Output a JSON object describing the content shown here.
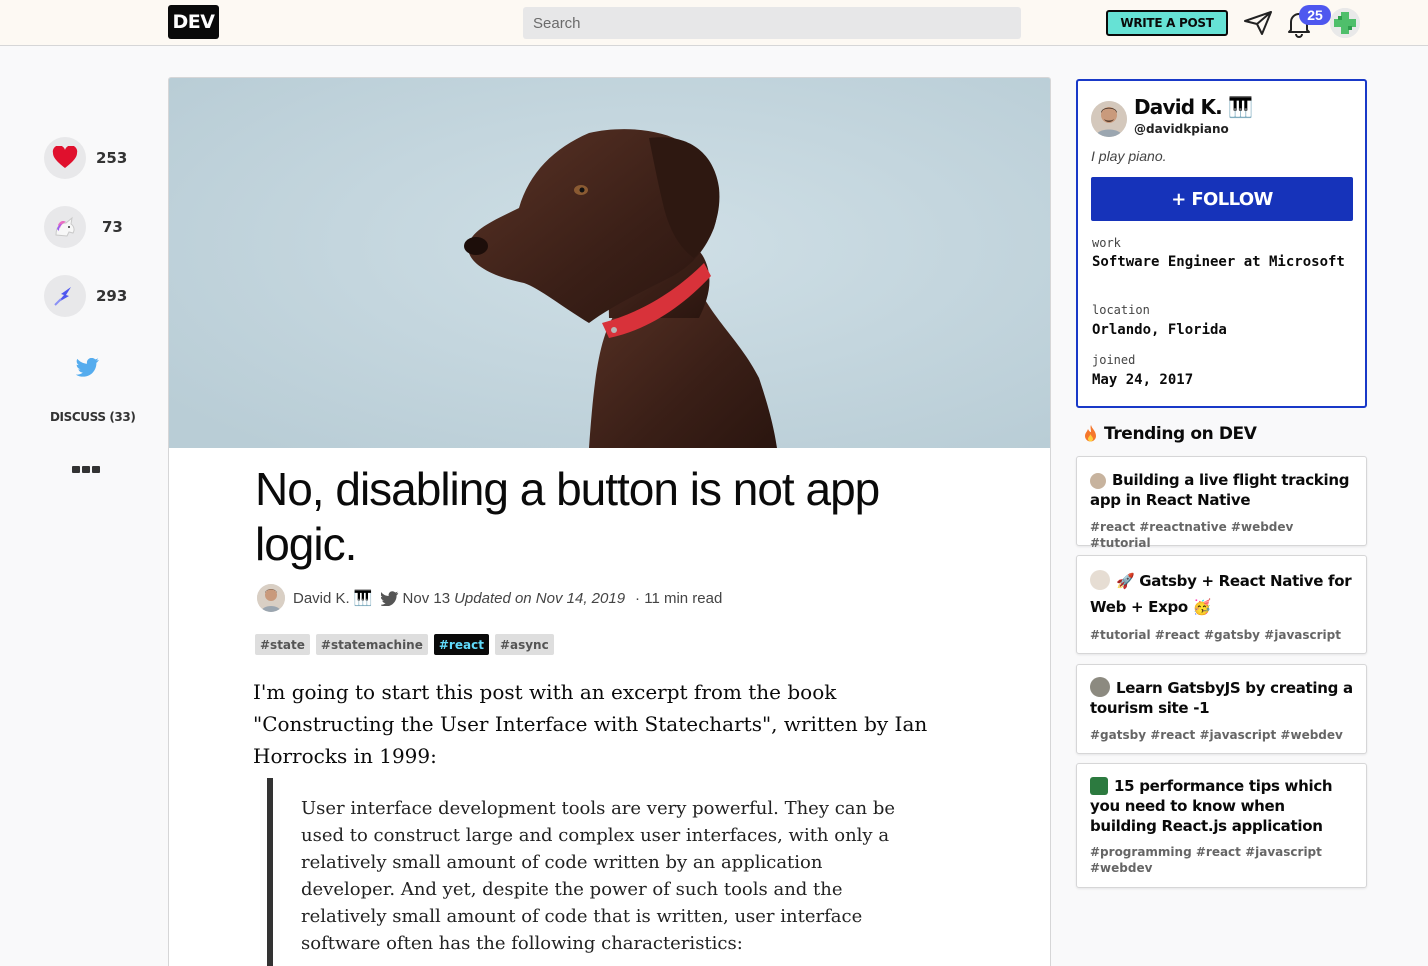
{
  "topbar": {
    "logo": "DEV",
    "search_placeholder": "Search",
    "write_label": "WRITE A POST",
    "notification_count": "25"
  },
  "reactions": {
    "hearts": "253",
    "unicorns": "73",
    "bookmarks": "293",
    "discuss_label": "DISCUSS (33)"
  },
  "article": {
    "title": "No, disabling a button is not app logic.",
    "author": "David K. 🎹",
    "date": "Nov 13",
    "updated": "Updated on Nov 14, 2019",
    "read_time": "· 11 min read",
    "tags": [
      "#state",
      "#statemachine",
      "#react",
      "#async"
    ],
    "intro": "I'm going to start this post with an excerpt from the book \"Constructing the User Interface with Statecharts\", written by Ian Horrocks in 1999:",
    "quote": "User interface development tools are very powerful. They can be used to construct large and complex user interfaces, with only a relatively small amount of code written by an application developer. And yet, despite the power of such tools and the relatively small amount of code that is written, user interface software often has the following characteristics:"
  },
  "profile": {
    "name": "David K. 🎹",
    "handle": "@davidkpiano",
    "bio": "I play piano.",
    "follow_label": "+ FOLLOW",
    "work_label": "work",
    "work_value": "Software Engineer at Microsoft",
    "location_label": "location",
    "location_value": "Orlando, Florida",
    "joined_label": "joined",
    "joined_value": "May 24, 2017"
  },
  "trending": {
    "title": "Trending on DEV",
    "items": [
      {
        "title": "Building a live flight tracking app in React Native",
        "tags": "#react #reactnative #webdev #tutorial"
      },
      {
        "title": "🚀 Gatsby + React Native for Web + Expo 🥳",
        "tags": "#tutorial #react #gatsby #javascript"
      },
      {
        "title": "Learn GatsbyJS by creating a tourism site -1",
        "tags": "#gatsby #react #javascript #webdev"
      },
      {
        "title": "15 performance tips which you need to know when building React.js application",
        "tags": "#programming #react #javascript #webdev"
      }
    ]
  },
  "colors": {
    "accent": "#1633ba",
    "write_button": "#66e2d5",
    "badge": "#4e57ef",
    "react_tag_text": "#61dafb"
  }
}
